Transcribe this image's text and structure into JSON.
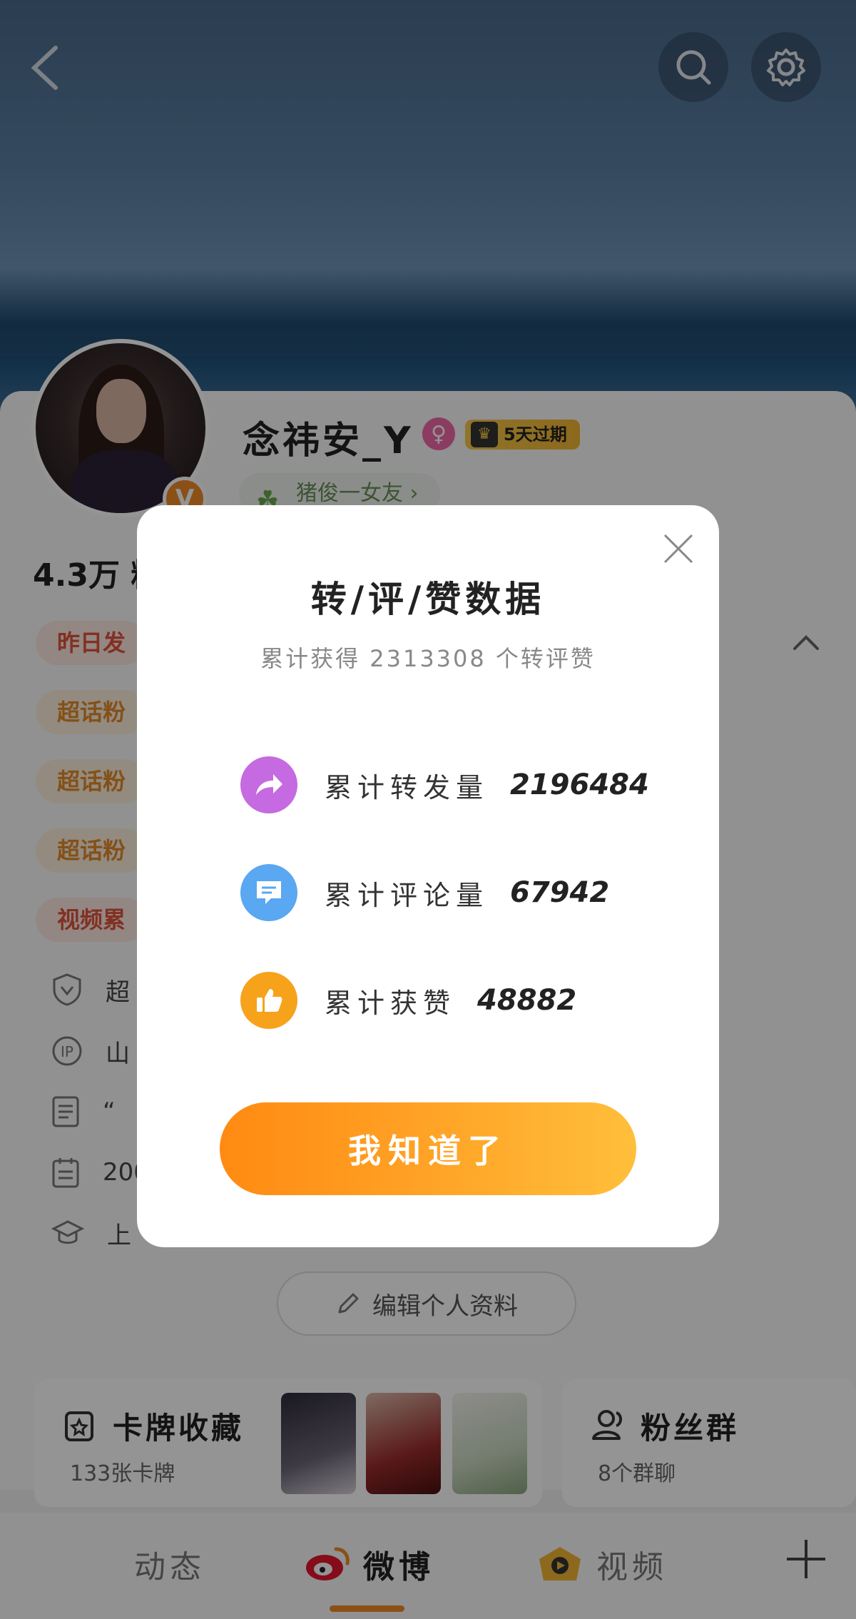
{
  "profile": {
    "username": "念祎安_Y",
    "gender_symbol": "♀",
    "vip_label": "5天过期",
    "verified_mark": "V",
    "tag": "猪俊一女友",
    "fans_count": "4.3万 粉",
    "pills": [
      "昨日发",
      "超话粉",
      "超话粉",
      "超话粉",
      "视频累"
    ],
    "info": [
      "超",
      "山",
      "“",
      "200",
      "上"
    ]
  },
  "edit_button": "编辑个人资料",
  "cards": {
    "cardpack": {
      "title": "卡牌收藏",
      "subtitle": "133张卡牌"
    },
    "fan_group": {
      "title": "粉丝群",
      "subtitle": "8个群聊"
    }
  },
  "tabs": [
    "动态",
    "微博",
    "视频"
  ],
  "modal": {
    "title": "转/评/赞数据",
    "subtitle": "累计获得 2313308 个转评赞",
    "stats": [
      {
        "label": "累计转发量",
        "value": "2196484",
        "icon": "share-icon",
        "color": "#c56ae0"
      },
      {
        "label": "累计评论量",
        "value": "67942",
        "icon": "comment-icon",
        "color": "#5aa7f2"
      },
      {
        "label": "累计获赞",
        "value": "48882",
        "icon": "thumbs-up-icon",
        "color": "#f7a21b"
      }
    ],
    "confirm_button": "我知道了"
  }
}
